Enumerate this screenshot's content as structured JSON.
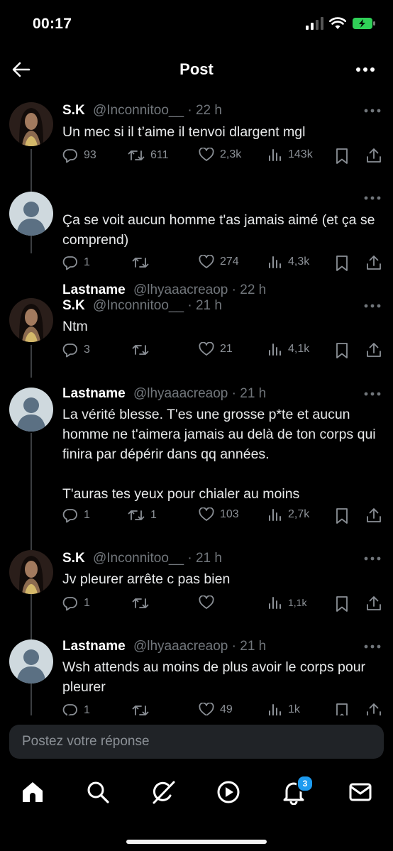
{
  "status_bar": {
    "time": "00:17"
  },
  "header": {
    "title": "Post"
  },
  "tweets": [
    {
      "name": "S.K",
      "handle": "@Inconnitoo__",
      "sep": "·",
      "time": "22 h",
      "avatar": "photo",
      "text": "Un mec si il t’aime il tenvoi dlargent mgl",
      "replies": "93",
      "retweets": "611",
      "likes": "2,3k",
      "views": "143k"
    },
    {
      "name": "Lastname",
      "handle": "@lhyaaacreaop",
      "sep": "·",
      "time": "22 h",
      "avatar": "default",
      "text": "Ça se voit aucun homme t'as jamais aimé (et ça se comprend)",
      "replies": "1",
      "retweets": "",
      "likes": "274",
      "views": "4,3k"
    },
    {
      "name": "S.K",
      "handle": "@Inconnitoo__",
      "sep": "·",
      "time": "21 h",
      "avatar": "photo",
      "text": "Ntm",
      "replies": "3",
      "retweets": "",
      "likes": "21",
      "views": "4,1k"
    },
    {
      "name": "Lastname",
      "handle": "@lhyaaacreaop",
      "sep": "·",
      "time": "21 h",
      "avatar": "default",
      "text": "La vérité blesse. T'es une grosse p*te  et aucun homme ne t'aimera jamais au delà de ton corps qui finira par dépérir dans qq années.\n\nT'auras tes yeux pour chialer au moins",
      "replies": "1",
      "retweets": "1",
      "likes": "103",
      "views": "2,7k"
    },
    {
      "name": "S.K",
      "handle": "@Inconnitoo__",
      "sep": "·",
      "time": "21 h",
      "avatar": "photo",
      "text": "Jv pleurer arrête c pas bien",
      "replies": "1",
      "retweets": "",
      "likes": "",
      "views": "1,1k"
    },
    {
      "name": "Lastname",
      "handle": "@lhyaaacreaop",
      "sep": "·",
      "time": "21 h",
      "avatar": "default",
      "text": "Wsh attends au moins de plus avoir le corps pour pleurer",
      "replies": "1",
      "retweets": "",
      "likes": "49",
      "views": "1k"
    }
  ],
  "reply": {
    "placeholder": "Postez votre réponse"
  },
  "tabbar": {
    "tabs": [
      "home-icon",
      "search-icon",
      "grok-icon",
      "video-icon",
      "notifications-icon",
      "messages-icon"
    ],
    "notification_badge": "3",
    "accent": "#1d9bf0"
  }
}
